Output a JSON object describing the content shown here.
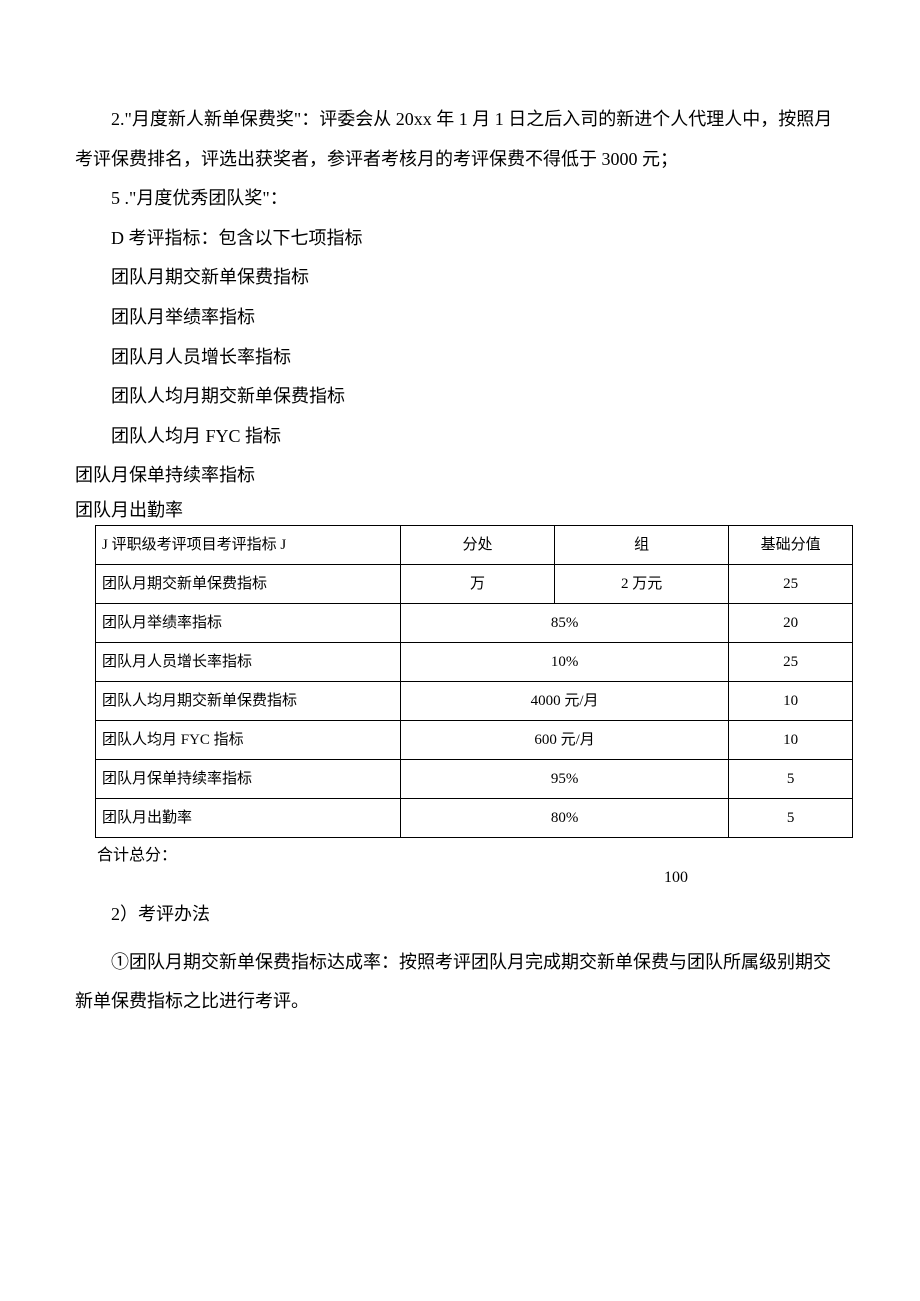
{
  "para1": "2.\"月度新人新单保费奖\"：评委会从 20xx 年 1 月 1 日之后入司的新进个人代理人中，按照月考评保费排名，评选出获奖者，参评者考核月的考评保费不得低于 3000 元；",
  "para2": "5 .\"月度优秀团队奖\"：",
  "para3": "D 考评指标：包含以下七项指标",
  "bullets": [
    "团队月期交新单保费指标",
    "团队月举绩率指标",
    "团队月人员增长率指标",
    "团队人均月期交新单保费指标",
    "团队人均月 FYC 指标"
  ],
  "flush1": "团队月保单持续率指标",
  "flush2": "团队月出勤率",
  "table": {
    "head": {
      "item": "J 评职级考评项目考评指标 J",
      "branch": "分处",
      "group": "组",
      "score": "基础分值"
    },
    "rows": [
      {
        "item": "团队月期交新单保费指标",
        "branch": "万",
        "group": "2 万元",
        "score": "25",
        "merge": false
      },
      {
        "item": "团队月举绩率指标",
        "merged": "85%",
        "score": "20",
        "merge": true
      },
      {
        "item": "团队月人员增长率指标",
        "merged": "10%",
        "score": "25",
        "merge": true
      },
      {
        "item": "团队人均月期交新单保费指标",
        "merged": "4000 元/月",
        "score": "10",
        "merge": true
      },
      {
        "item": "团队人均月 FYC 指标",
        "merged": "600 元/月",
        "score": "10",
        "merge": true
      },
      {
        "item": "团队月保单持续率指标",
        "merged": "95%",
        "score": "5",
        "merge": true
      },
      {
        "item": "团队月出勤率",
        "merged": "80%",
        "score": "5",
        "merge": true
      }
    ]
  },
  "total_label": "合计总分：",
  "total_value": "100",
  "sec2_head": "2）考评办法",
  "sec2_body": "①团队月期交新单保费指标达成率：按照考评团队月完成期交新单保费与团队所属级别期交新单保费指标之比进行考评。"
}
